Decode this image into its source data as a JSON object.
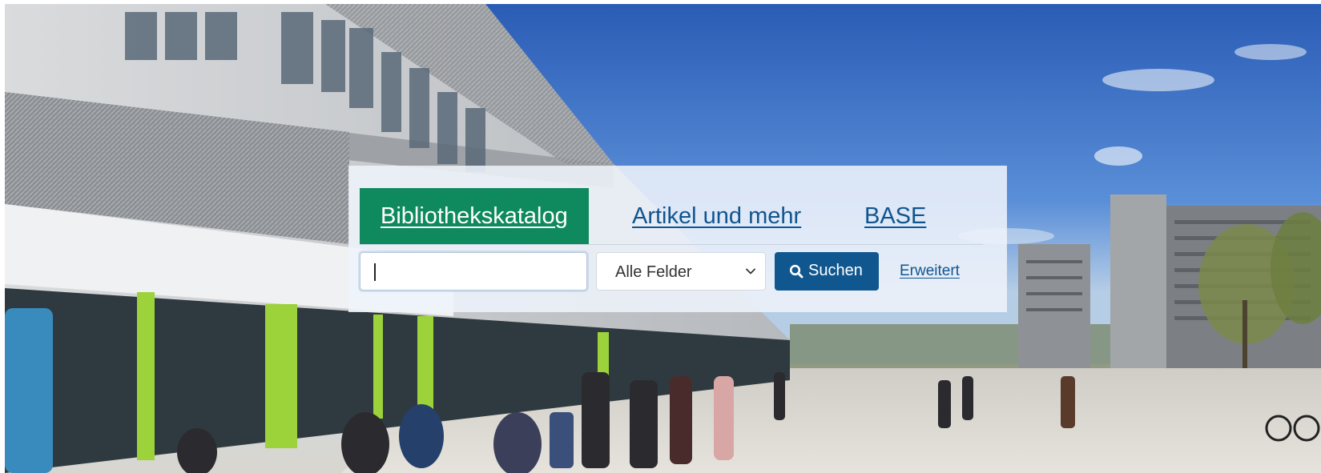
{
  "tabs": [
    {
      "label": "Bibliothekskatalog",
      "active": true
    },
    {
      "label": "Artikel und mehr",
      "active": false
    },
    {
      "label": "BASE",
      "active": false
    }
  ],
  "search": {
    "query": "",
    "field_selected": "Alle Felder",
    "submit_label": "Suchen",
    "advanced_label": "Erweitert"
  },
  "icons": {
    "submit": "search-icon",
    "select": "chevron-down-icon"
  },
  "colors": {
    "active_tab": "#0f8a5f",
    "link": "#10558f",
    "button": "#10578f"
  }
}
